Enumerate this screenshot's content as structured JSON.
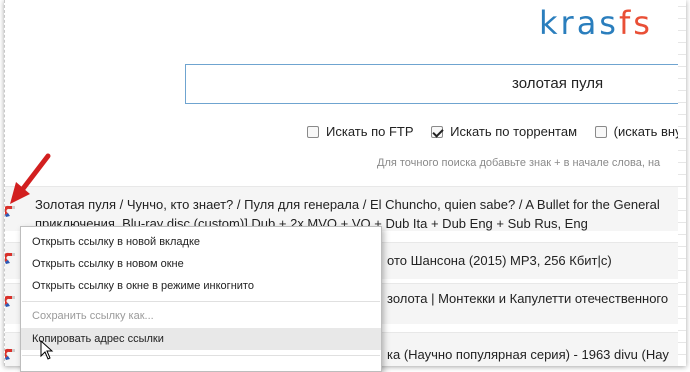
{
  "logo": {
    "part1": "kras",
    "part2": "fs"
  },
  "search": {
    "value": "золотая пуля"
  },
  "options": [
    {
      "label": "Искать по FTP",
      "checked": false
    },
    {
      "label": "Искать по торрентам",
      "checked": true
    },
    {
      "label": "(искать вну",
      "checked": false
    }
  ],
  "hint": "Для точного поиска добавьте знак + в начале слова, на",
  "results": [
    {
      "line1": "Золотая пуля / Чунчо, кто знает? / Пуля для генерала / El Chuncho, quien sabe? / A Bullet for the General",
      "line2": "приключения, Blu-ray disc (custom)] Dub + 2x MVO + VO + Dub Ita + Dub Eng + Sub Rus, Eng"
    },
    {
      "line1": "ото Шансона (2015) MP3, 256 Кбит|с)"
    },
    {
      "line1": "золота | Монтекки и Капулетти отечественного"
    },
    {
      "line1": "ка (Научно популярная серия) - 1963 divu (Hay"
    }
  ],
  "context_menu": {
    "items": [
      {
        "label": "Открыть ссылку в новой вкладке",
        "disabled": false
      },
      {
        "label": "Открыть ссылку в новом окне",
        "disabled": false
      },
      {
        "label": "Открыть ссылку в окне в режиме инкогнито",
        "disabled": false
      },
      {
        "label": "Сохранить ссылку как...",
        "disabled": true
      },
      {
        "label": "Копировать адрес ссылки",
        "disabled": false,
        "highlighted": true
      }
    ]
  },
  "colors": {
    "logo_blue": "#2a7ebd",
    "logo_red": "#e94f36",
    "search_border": "#6fa4d0",
    "arrow_red": "#d21f1f"
  }
}
